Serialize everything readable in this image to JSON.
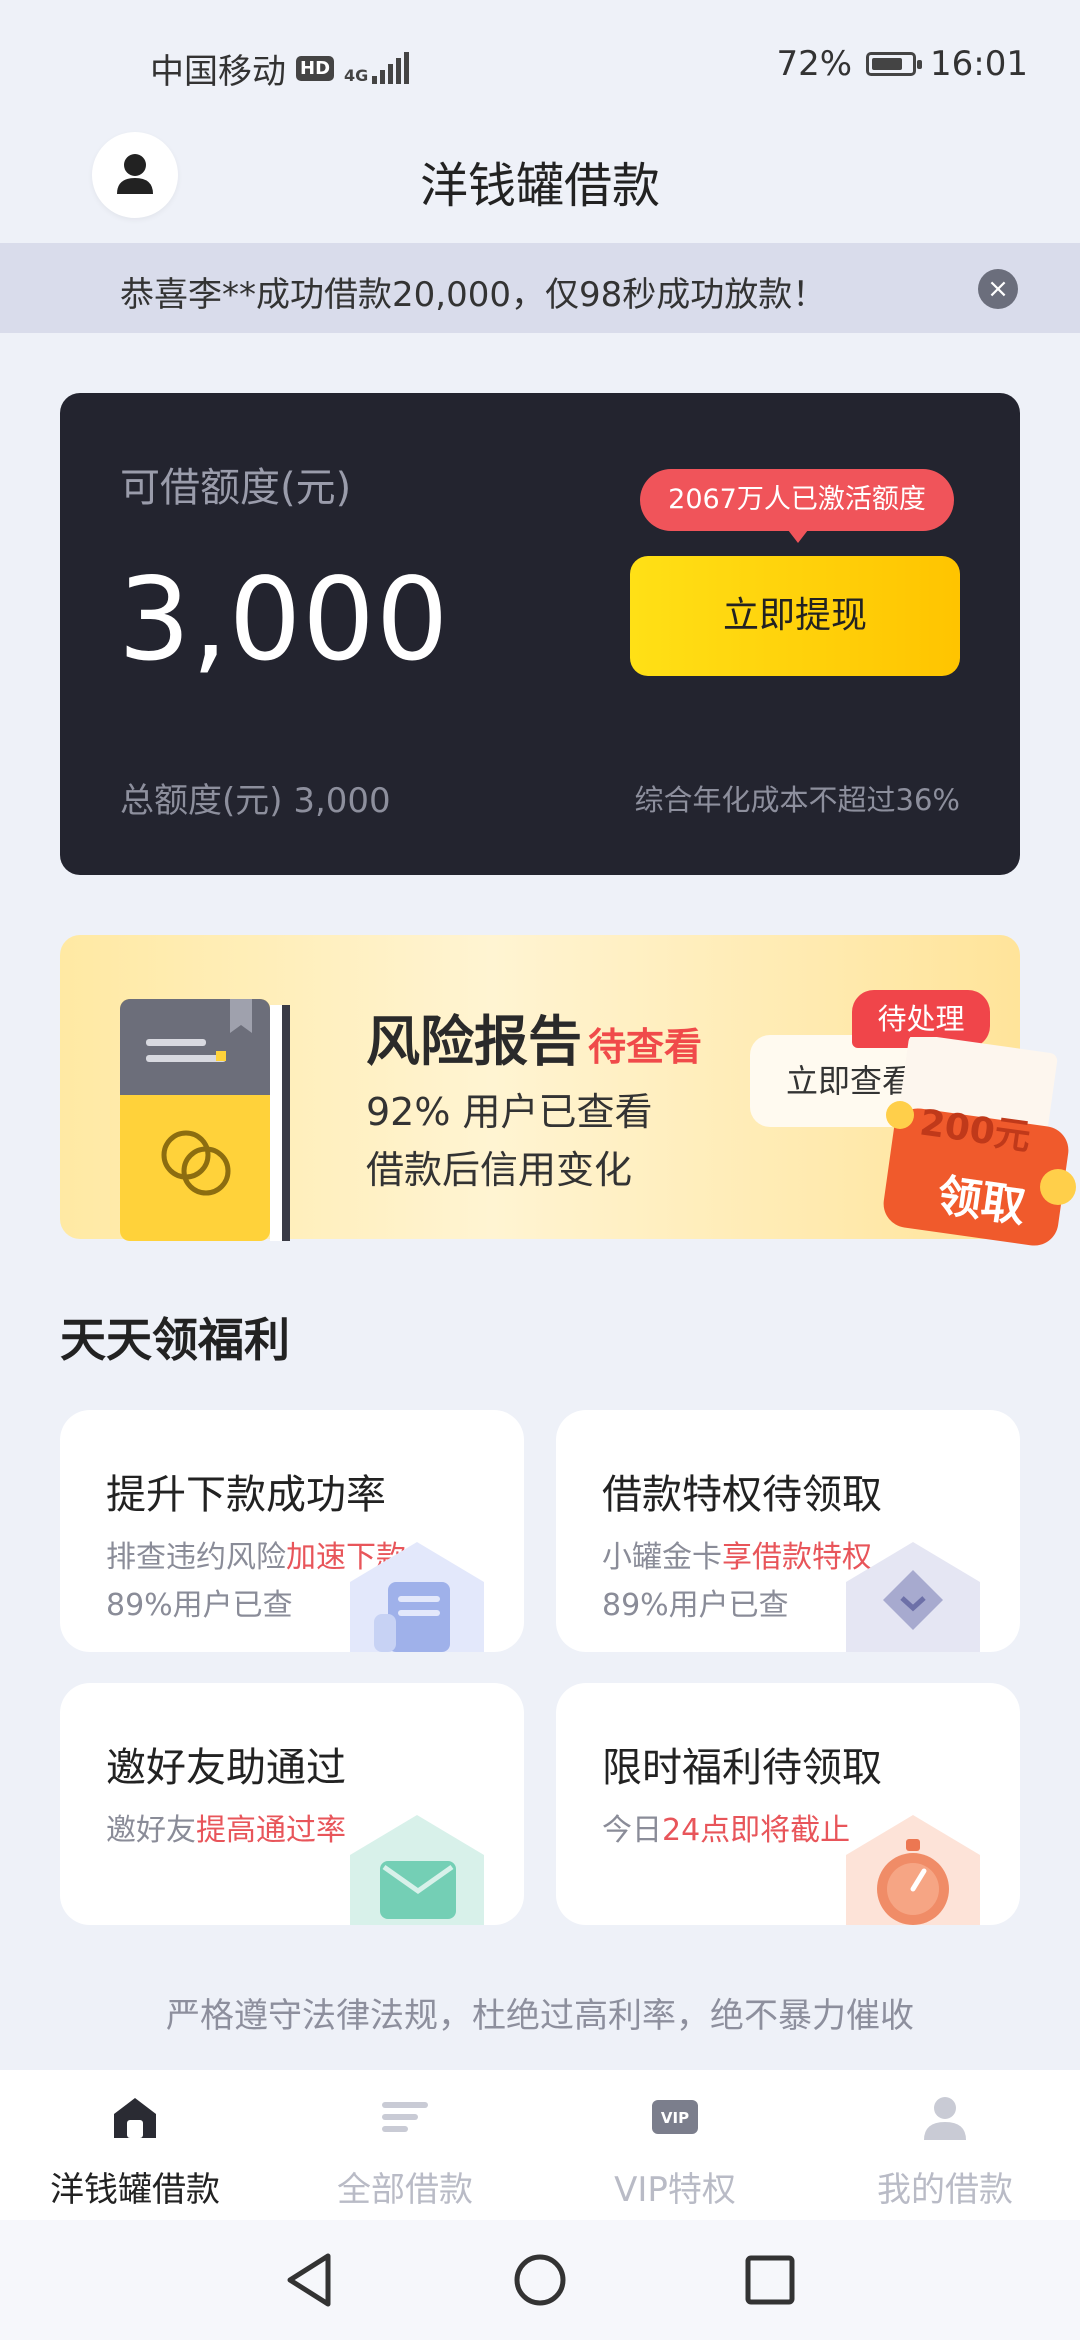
{
  "status_bar": {
    "carrier": "中国移动",
    "hd": "HD",
    "network": "4G",
    "battery": "72%",
    "time": "16:01"
  },
  "header": {
    "title": "洋钱罐借款"
  },
  "notice": {
    "text": "恭喜李**成功借款20,000，仅98秒成功放款！"
  },
  "credit": {
    "label": "可借额度(元)",
    "amount": "3,000",
    "bubble": "2067万人已激活额度",
    "cta": "立即提现",
    "total": "总额度(元) 3,000",
    "rate_note": "综合年化成本不超过36%"
  },
  "risk_banner": {
    "title": "风险报告",
    "title_tag": "待查看",
    "line1": "92% 用户已查看",
    "line2": "借款后信用变化",
    "badge": "待处理",
    "button": "立即查看",
    "coupon_amount": "200元",
    "coupon_action": "领取"
  },
  "welfare": {
    "title": "天天领福利",
    "cards": [
      {
        "title": "提升下款成功率",
        "sub_prefix": "排查违约风险",
        "sub_highlight": "加速下款",
        "sub2": "89%用户已查"
      },
      {
        "title": "借款特权待领取",
        "sub_prefix": "小罐金卡",
        "sub_highlight": "享借款特权",
        "sub2": "89%用户已查"
      },
      {
        "title": "邀好友助通过",
        "sub_prefix": "邀好友",
        "sub_highlight": "提高通过率",
        "sub2": ""
      },
      {
        "title": "限时福利待领取",
        "sub_prefix": "今日",
        "sub_highlight": "24点即将截止",
        "sub2": ""
      }
    ]
  },
  "compliance": "严格遵守法律法规，杜绝过高利率，绝不暴力催收",
  "bottom_nav": [
    {
      "label": "洋钱罐借款",
      "icon": "home-icon",
      "active": true
    },
    {
      "label": "全部借款",
      "icon": "list-icon",
      "active": false
    },
    {
      "label": "VIP特权",
      "icon": "vip-icon",
      "active": false
    },
    {
      "label": "我的借款",
      "icon": "user-icon",
      "active": false
    }
  ],
  "colors": {
    "accent_red": "#f0545a",
    "cta_yellow": "#ffd000",
    "card_dark": "#23242f",
    "bg": "#eef1f8"
  }
}
